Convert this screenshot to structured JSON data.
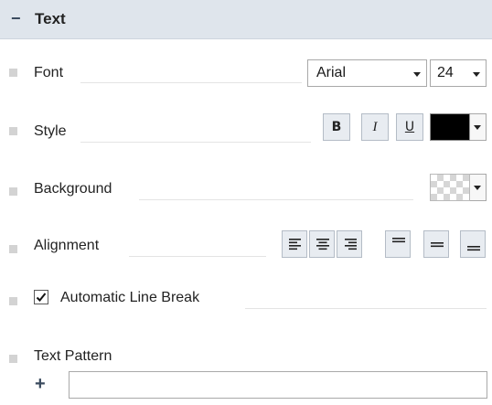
{
  "section": {
    "collapse_icon": "minus-icon",
    "title": "Text"
  },
  "font": {
    "label": "Font",
    "family": "Arial",
    "size": "24"
  },
  "style": {
    "label": "Style",
    "bold": "B",
    "italic": "I",
    "underline": "U",
    "color": "#000000"
  },
  "background": {
    "label": "Background",
    "swatch": "transparent-checker"
  },
  "alignment": {
    "label": "Alignment",
    "buttons": [
      {
        "icon": "align-left-icon"
      },
      {
        "icon": "align-center-icon"
      },
      {
        "icon": "align-right-icon"
      },
      {
        "icon": "align-top-icon"
      },
      {
        "icon": "align-middle-icon"
      },
      {
        "icon": "align-bottom-icon"
      }
    ]
  },
  "line_break": {
    "label": "Automatic Line Break",
    "checked": true
  },
  "text_pattern": {
    "label": "Text Pattern",
    "add_icon": "plus-icon",
    "value": ""
  },
  "colors": {
    "header_bg": "#dfe5ec",
    "button_bg": "#e8ecf1",
    "bullet": "#d3d3d3"
  }
}
